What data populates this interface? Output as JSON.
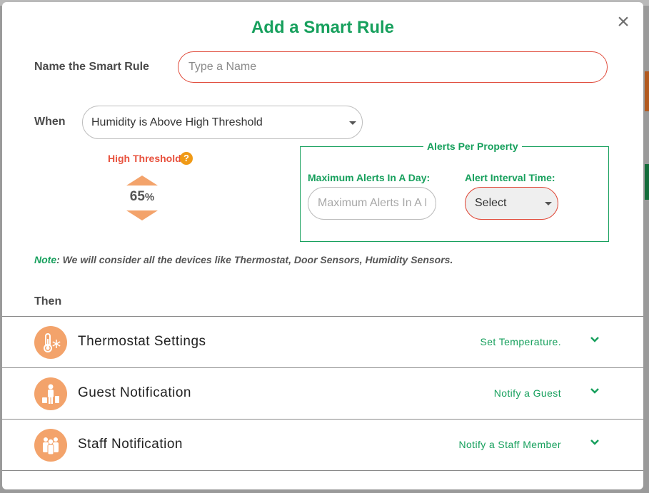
{
  "modal": {
    "title": "Add a Smart Rule",
    "close_label": "×"
  },
  "name_field": {
    "label": "Name the Smart Rule",
    "placeholder": "Type a Name",
    "value": ""
  },
  "when": {
    "label": "When",
    "selected": "Humidity is Above High Threshold"
  },
  "threshold": {
    "label": "High Threshold",
    "help_icon": "question-circle-icon",
    "value": "65",
    "unit": "%"
  },
  "alerts_per_property": {
    "legend": "Alerts Per Property",
    "max_alerts_label": "Maximum Alerts In A Day:",
    "max_alerts_placeholder": "Maximum Alerts In A Day",
    "interval_label": "Alert Interval Time:",
    "interval_selected": "Select"
  },
  "note": {
    "key": "Note",
    "text": ": We will consider all the devices like Thermostat, Door Sensors, Humidity Sensors."
  },
  "then": {
    "label": "Then",
    "actions": [
      {
        "title": "Thermostat Settings",
        "link": "Set Temperature.",
        "icon": "thermostat-snowflake-icon"
      },
      {
        "title": "Guest Notification",
        "link": "Notify a Guest",
        "icon": "guest-luggage-icon"
      },
      {
        "title": "Staff Notification",
        "link": "Notify a Staff Member",
        "icon": "staff-group-icon"
      }
    ]
  },
  "colors": {
    "brand_green": "#17a05d",
    "accent_orange": "#f3a36b",
    "error_red": "#e04a3a"
  }
}
